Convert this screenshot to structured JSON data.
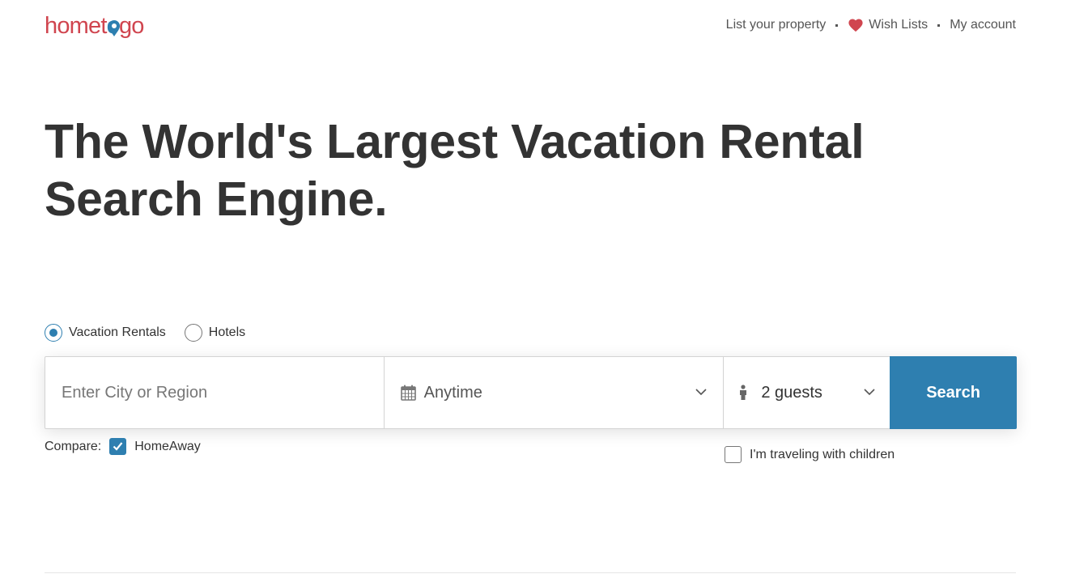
{
  "brand": {
    "logo_text_a": "homet",
    "logo_text_o": "o",
    "logo_text_b": "go",
    "primary_color": "#d0454f",
    "accent_color": "#2e7fb0"
  },
  "nav": {
    "list_property": "List your property",
    "wish_lists": "Wish Lists",
    "wish_icon": "heart-icon",
    "my_account": "My account"
  },
  "hero": {
    "line1": "The World's Largest Vacation Rental",
    "line2": "Search Engine."
  },
  "search": {
    "types": [
      {
        "label": "Vacation Rentals",
        "checked": true
      },
      {
        "label": "Hotels",
        "checked": false
      }
    ],
    "destination_placeholder": "Enter City or Region",
    "destination_value": "",
    "date_icon": "calendar-icon",
    "date_value": "Anytime",
    "guests_icon": "person-icon",
    "guests_value": "2 guests",
    "button_label": "Search"
  },
  "compare": {
    "label": "Compare:",
    "option_label": "HomeAway",
    "checked": true
  },
  "children": {
    "label": "I'm traveling with children",
    "checked": false
  }
}
